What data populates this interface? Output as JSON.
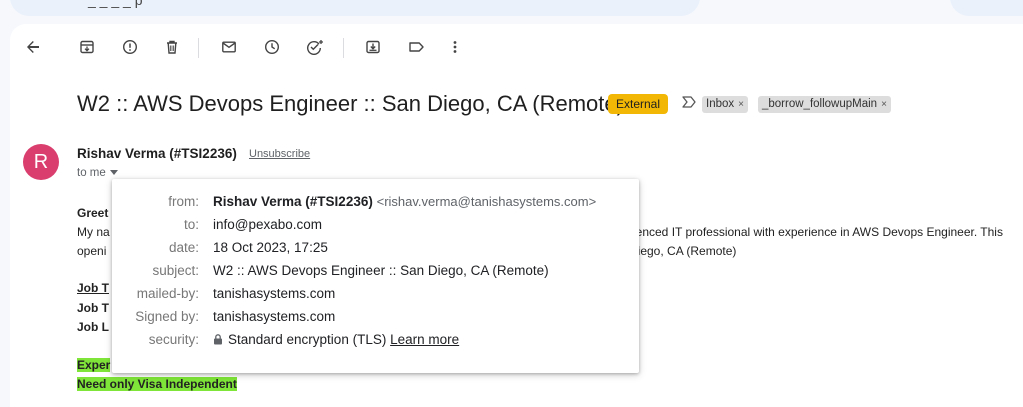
{
  "search": {
    "text": "_ _ _ _ p"
  },
  "toolbar": {
    "items": [
      "back-icon",
      "archive-icon",
      "report-spam-icon",
      "delete-icon",
      "mark-unread-icon",
      "snooze-icon",
      "add-task-icon",
      "move-to-icon",
      "label-icon",
      "more-icon"
    ]
  },
  "email": {
    "subject": "W2 :: AWS Devops Engineer :: San Diego, CA (Remote)",
    "external_badge": "External",
    "labels": [
      {
        "label": "Inbox",
        "close": "×"
      },
      {
        "label": "_borrow_followupMain",
        "close": "×"
      }
    ],
    "sender": {
      "avatar_letter": "R",
      "avatar_color": "#d93e6e",
      "name": "Rishav Verma (#TSI2236)",
      "unsubscribe": "Unsubscribe",
      "to": "to me"
    },
    "body": {
      "greeting": "Greet",
      "line1_start": "My na",
      "line1_end": "rienced IT professional with experience in AWS Devops Engineer. This",
      "line2_start": "openi",
      "line2_end": "Diego, CA (Remote)",
      "job1": "Job T",
      "job2": "Job T",
      "job3": "Job L",
      "exp": "Exper",
      "visa": "Need only Visa Independent"
    }
  },
  "details": {
    "from_label": "from:",
    "from_name": "Rishav Verma (#TSI2236)",
    "from_email": "<rishav.verma@tanishasystems.com>",
    "to_label": "to:",
    "to_value": "info@pexabo.com",
    "date_label": "date:",
    "date_value": "18 Oct 2023, 17:25",
    "subject_label": "subject:",
    "subject_value": "W2 :: AWS Devops Engineer :: San Diego, CA (Remote)",
    "mailedby_label": "mailed-by:",
    "mailedby_value": "tanishasystems.com",
    "signedby_label": "Signed by:",
    "signedby_value": "tanishasystems.com",
    "security_label": "security:",
    "security_value": "Standard encryption (TLS)",
    "learn_more": "Learn more"
  }
}
